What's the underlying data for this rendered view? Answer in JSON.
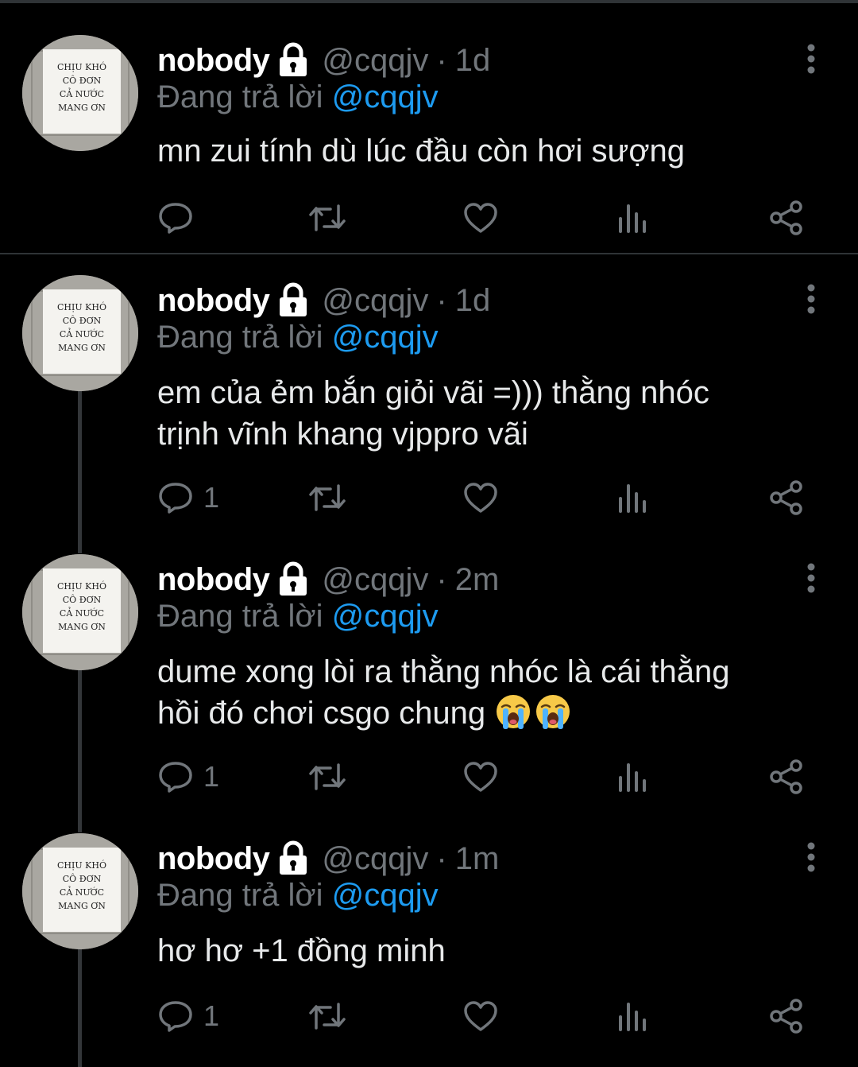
{
  "tweets": [
    {
      "name": "nobody",
      "handle": "@cqqjv",
      "separator": "·",
      "time": "1d",
      "replying_prefix": "Đang trả lời ",
      "replying_to": "@cqqjv",
      "text": "mn zui tính dù lúc đầu còn hơi sượng",
      "reply_count": ""
    },
    {
      "name": "nobody",
      "handle": "@cqqjv",
      "separator": "·",
      "time": "1d",
      "replying_prefix": "Đang trả lời ",
      "replying_to": "@cqqjv",
      "text_line1": "em của ẻm bắn giỏi vãi =))) thằng nhóc",
      "text_line2": "trịnh vĩnh khang vjppro vãi",
      "reply_count": "1"
    },
    {
      "name": "nobody",
      "handle": "@cqqjv",
      "separator": "·",
      "time": "2m",
      "replying_prefix": "Đang trả lời ",
      "replying_to": "@cqqjv",
      "text_line1": "dume xong lòi ra thằng nhóc là cái thằng",
      "text_line2": "hồi đó chơi csgo chung",
      "reply_count": "1"
    },
    {
      "name": "nobody",
      "handle": "@cqqjv",
      "separator": "·",
      "time": "1m",
      "replying_prefix": "Đang trả lời ",
      "replying_to": "@cqqjv",
      "text": "hơ hơ +1 đồng minh",
      "reply_count": "1"
    }
  ],
  "avatar_sign": {
    "line1": "CHỊU KHÓ",
    "line2": "CÔ ĐƠN",
    "line3": "CẢ NƯỚC",
    "line4": "MANG ƠN"
  },
  "icons": {
    "lock": "lock-icon",
    "more": "more-vertical-icon",
    "reply": "comment-icon",
    "retweet": "retweet-icon",
    "like": "heart-icon",
    "views": "analytics-icon",
    "share": "share-icon",
    "emoji": "loudly-crying-face-emoji"
  },
  "colors": {
    "background": "#000000",
    "text": "#e7e9ea",
    "secondary": "#71767b",
    "mention": "#1d9bf0",
    "divider": "#2f3336",
    "thread_line": "#333639"
  }
}
